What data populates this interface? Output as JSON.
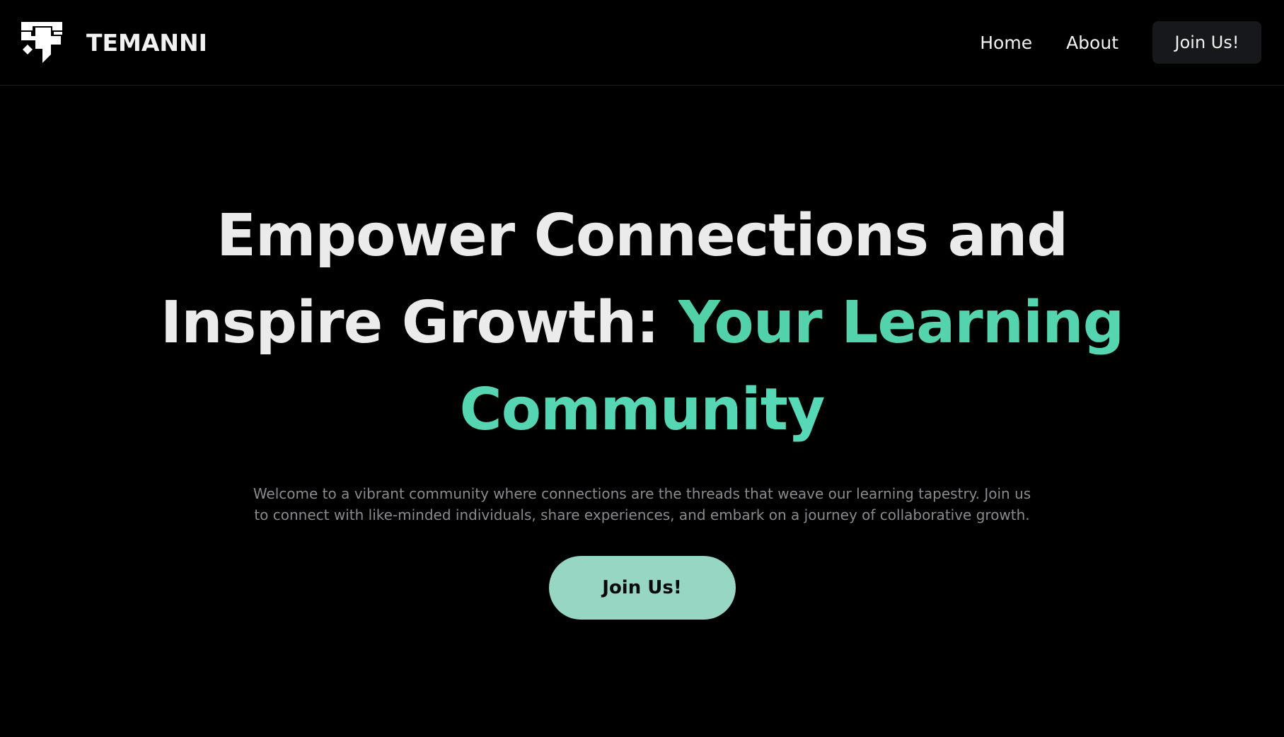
{
  "brand": {
    "name": "TEMANNI",
    "logo_icon": "temanni-logo-icon"
  },
  "nav": {
    "links": [
      {
        "label": "Home"
      },
      {
        "label": "About"
      }
    ],
    "join_label": "Join Us!"
  },
  "hero": {
    "headline_part1": "Empower Connections and Inspire Growth:",
    "headline_accent": "Your Learning Community",
    "description": "Welcome to a vibrant community where connections are the threads that weave our learning tapestry. Join us to connect with like-minded individuals, share experiences, and embark on a journey of collaborative growth.",
    "cta_label": "Join Us!"
  },
  "colors": {
    "background": "#000000",
    "text": "#ebebec",
    "accent": "#5dd6b1",
    "cta_background": "#96d6c3",
    "nav_button_background": "#17181b",
    "muted_text": "#8a8a8e"
  }
}
